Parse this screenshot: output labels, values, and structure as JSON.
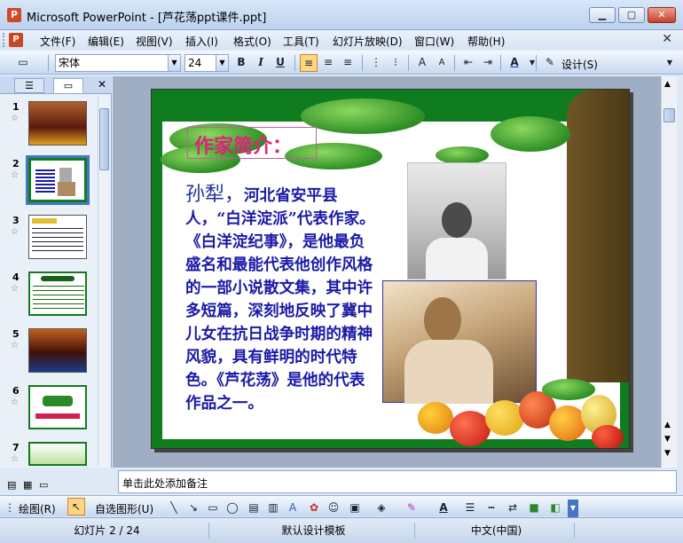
{
  "window": {
    "title": "Microsoft PowerPoint - [芦花荡ppt课件.ppt]",
    "app_icon": "P",
    "minimize": "▁",
    "maximize": "▢",
    "close": "✕"
  },
  "menu": {
    "items": [
      "文件(F)",
      "编辑(E)",
      "视图(V)",
      "插入(I)",
      "格式(O)",
      "工具(T)",
      "幻灯片放映(D)",
      "窗口(W)",
      "帮助(H)"
    ],
    "close": "✕"
  },
  "toolbar": {
    "font_name": "宋体",
    "font_size": "24",
    "bold": "B",
    "italic": "I",
    "underline": "U",
    "design_label": "设计(S)"
  },
  "left_pane": {
    "slides": [
      {
        "num": "1"
      },
      {
        "num": "2"
      },
      {
        "num": "3"
      },
      {
        "num": "4"
      },
      {
        "num": "5"
      },
      {
        "num": "6"
      },
      {
        "num": "7"
      }
    ],
    "selected": 2
  },
  "slide": {
    "heading": "作家简介：",
    "author_name": "孙犁，",
    "body": "河北省安平县人，“白洋淀派”代表作家。《白洋淀纪事》，是他最负盛名和最能代表他创作风格的一部小说散文集，其中许多短篇，深刻地反映了冀中儿女在抗日战争时期的精神风貌，具有鲜明的时代特色。《芦花荡》是他的代表作品之一。"
  },
  "notes": {
    "placeholder": "单击此处添加备注"
  },
  "drawbar": {
    "draw_label": "绘图(R)",
    "autoshape_label": "自选图形(U)"
  },
  "status": {
    "slide_counter": "幻灯片 2 / 24",
    "design_template": "默认设计模板",
    "language": "中文(中国)"
  }
}
